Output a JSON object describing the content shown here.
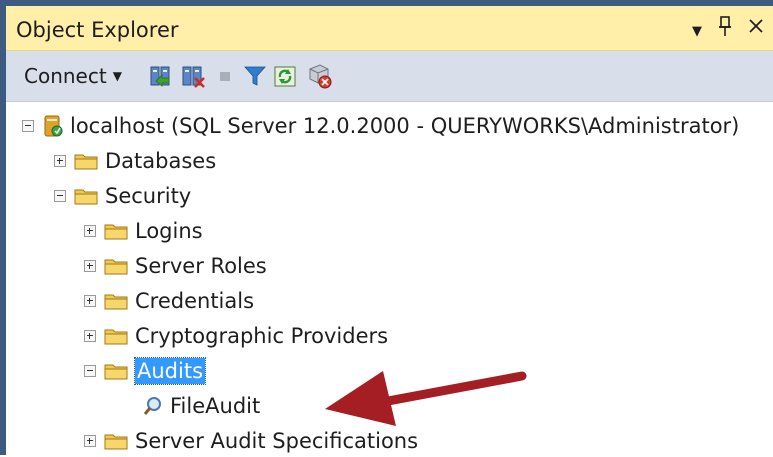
{
  "panel": {
    "title": "Object Explorer",
    "dropdown_icon": "▼",
    "pin_icon": "📌",
    "close_icon": "✕"
  },
  "toolbar": {
    "connect_label": "Connect",
    "icons": [
      "connect-icon",
      "disconnect-icon",
      "stop-icon",
      "filter-icon",
      "refresh-icon",
      "activity-monitor-icon"
    ]
  },
  "tree": {
    "root": "localhost (SQL Server 12.0.2000 - QUERYWORKS\\Administrator)",
    "databases": "Databases",
    "security": "Security",
    "logins": "Logins",
    "server_roles": "Server Roles",
    "credentials": "Credentials",
    "crypto_providers": "Cryptographic Providers",
    "audits": "Audits",
    "file_audit": "FileAudit",
    "server_audit_specs": "Server Audit Specifications"
  },
  "annotation": {
    "arrow_color": "#a51e23"
  },
  "colors": {
    "frame": "#3d5a80",
    "title_bg": "#ffefa8",
    "toolbar_bg": "#d8deea",
    "selection": "#3399ff"
  }
}
